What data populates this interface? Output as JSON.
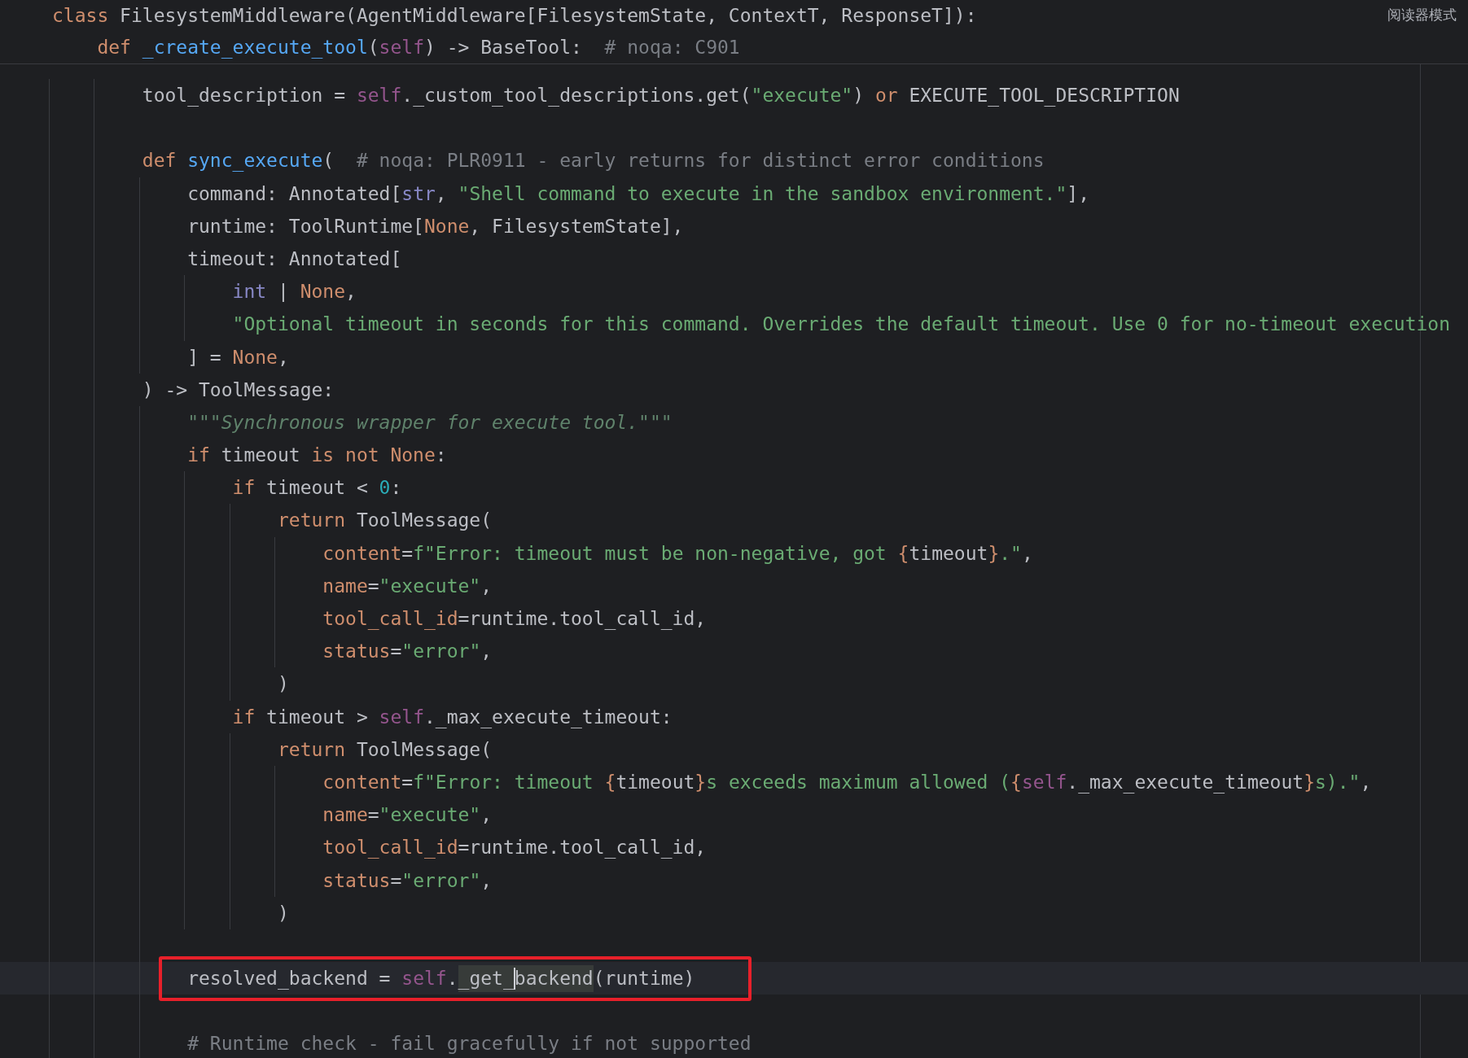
{
  "reader_mode_label": "阅读器模式",
  "sticky_lines": [
    {
      "tokens": [
        {
          "text": "class",
          "kind": "kw"
        },
        {
          "text": " FilesystemMiddleware(AgentMiddleware[FilesystemState, ContextT, ResponseT]):",
          "kind": "plain"
        }
      ]
    },
    {
      "tokens": [
        {
          "text": "    def ",
          "kind": "kw"
        },
        {
          "text": "_create_execute_tool",
          "kind": "fn"
        },
        {
          "text": "(",
          "kind": "plain"
        },
        {
          "text": "self",
          "kind": "self"
        },
        {
          "text": ") -> BaseTool:  ",
          "kind": "plain"
        },
        {
          "text": "# noqa: C901",
          "kind": "cmt"
        }
      ]
    }
  ],
  "lines": [
    {
      "kind": "code",
      "tokens": [
        {
          "text": "        tool_description = ",
          "kind": "plain"
        },
        {
          "text": "self",
          "kind": "self"
        },
        {
          "text": "._custom_tool_descriptions.get(",
          "kind": "plain"
        },
        {
          "text": "\"execute\"",
          "kind": "str"
        },
        {
          "text": ") ",
          "kind": "plain"
        },
        {
          "text": "or",
          "kind": "kw"
        },
        {
          "text": " EXECUTE_TOOL_DESCRIPTION",
          "kind": "plain"
        }
      ]
    },
    {
      "kind": "blank"
    },
    {
      "kind": "code",
      "tokens": [
        {
          "text": "        def ",
          "kind": "kw"
        },
        {
          "text": "sync_execute",
          "kind": "fn"
        },
        {
          "text": "(  ",
          "kind": "plain"
        },
        {
          "text": "# noqa: PLR0911 - early returns for distinct error conditions",
          "kind": "cmt"
        }
      ]
    },
    {
      "kind": "code",
      "tokens": [
        {
          "text": "            command: Annotated[",
          "kind": "plain"
        },
        {
          "text": "str",
          "kind": "builtin"
        },
        {
          "text": ", ",
          "kind": "plain"
        },
        {
          "text": "\"Shell command to execute in the sandbox environment.\"",
          "kind": "str"
        },
        {
          "text": "],",
          "kind": "plain"
        }
      ]
    },
    {
      "kind": "code",
      "tokens": [
        {
          "text": "            runtime: ToolRuntime[",
          "kind": "plain"
        },
        {
          "text": "None",
          "kind": "kw"
        },
        {
          "text": ", FilesystemState],",
          "kind": "plain"
        }
      ]
    },
    {
      "kind": "code",
      "tokens": [
        {
          "text": "            timeout: Annotated[",
          "kind": "plain"
        }
      ]
    },
    {
      "kind": "code",
      "tokens": [
        {
          "text": "                int",
          "kind": "builtin"
        },
        {
          "text": " | ",
          "kind": "plain"
        },
        {
          "text": "None",
          "kind": "kw"
        },
        {
          "text": ",",
          "kind": "plain"
        }
      ]
    },
    {
      "kind": "code",
      "tokens": [
        {
          "text": "                \"Optional timeout in seconds for this command. Overrides the default timeout. Use 0 for no-timeout execution",
          "kind": "str"
        }
      ]
    },
    {
      "kind": "code",
      "tokens": [
        {
          "text": "            ] = ",
          "kind": "plain"
        },
        {
          "text": "None",
          "kind": "kw"
        },
        {
          "text": ",",
          "kind": "plain"
        }
      ]
    },
    {
      "kind": "code",
      "tokens": [
        {
          "text": "        ) -> ToolMessage:",
          "kind": "plain"
        }
      ]
    },
    {
      "kind": "code",
      "tokens": [
        {
          "text": "            \"\"\"Synchronous wrapper for execute tool.\"\"\"",
          "kind": "doc"
        }
      ]
    },
    {
      "kind": "code",
      "tokens": [
        {
          "text": "            if",
          "kind": "kw"
        },
        {
          "text": " timeout ",
          "kind": "plain"
        },
        {
          "text": "is not None",
          "kind": "kw"
        },
        {
          "text": ":",
          "kind": "plain"
        }
      ]
    },
    {
      "kind": "code",
      "tokens": [
        {
          "text": "                if",
          "kind": "kw"
        },
        {
          "text": " timeout < ",
          "kind": "plain"
        },
        {
          "text": "0",
          "kind": "num"
        },
        {
          "text": ":",
          "kind": "plain"
        }
      ]
    },
    {
      "kind": "code",
      "tokens": [
        {
          "text": "                    return",
          "kind": "kw"
        },
        {
          "text": " ToolMessage(",
          "kind": "plain"
        }
      ]
    },
    {
      "kind": "code",
      "tokens": [
        {
          "text": "                        content",
          "kind": "param"
        },
        {
          "text": "=",
          "kind": "plain"
        },
        {
          "text": "f\"Error: timeout must be non-negative, got ",
          "kind": "str"
        },
        {
          "text": "{",
          "kind": "kw"
        },
        {
          "text": "timeout",
          "kind": "plain"
        },
        {
          "text": "}",
          "kind": "kw"
        },
        {
          "text": ".\"",
          "kind": "str"
        },
        {
          "text": ",",
          "kind": "plain"
        }
      ]
    },
    {
      "kind": "code",
      "tokens": [
        {
          "text": "                        name",
          "kind": "param"
        },
        {
          "text": "=",
          "kind": "plain"
        },
        {
          "text": "\"execute\"",
          "kind": "str"
        },
        {
          "text": ",",
          "kind": "plain"
        }
      ]
    },
    {
      "kind": "code",
      "tokens": [
        {
          "text": "                        tool_call_id",
          "kind": "param"
        },
        {
          "text": "=runtime.tool_call_id,",
          "kind": "plain"
        }
      ]
    },
    {
      "kind": "code",
      "tokens": [
        {
          "text": "                        status",
          "kind": "param"
        },
        {
          "text": "=",
          "kind": "plain"
        },
        {
          "text": "\"error\"",
          "kind": "str"
        },
        {
          "text": ",",
          "kind": "plain"
        }
      ]
    },
    {
      "kind": "code",
      "tokens": [
        {
          "text": "                    )",
          "kind": "plain"
        }
      ]
    },
    {
      "kind": "code",
      "tokens": [
        {
          "text": "                if",
          "kind": "kw"
        },
        {
          "text": " timeout > ",
          "kind": "plain"
        },
        {
          "text": "self",
          "kind": "self"
        },
        {
          "text": "._max_execute_timeout:",
          "kind": "plain"
        }
      ]
    },
    {
      "kind": "code",
      "tokens": [
        {
          "text": "                    return",
          "kind": "kw"
        },
        {
          "text": " ToolMessage(",
          "kind": "plain"
        }
      ]
    },
    {
      "kind": "code",
      "tokens": [
        {
          "text": "                        content",
          "kind": "param"
        },
        {
          "text": "=",
          "kind": "plain"
        },
        {
          "text": "f\"Error: timeout ",
          "kind": "str"
        },
        {
          "text": "{",
          "kind": "kw"
        },
        {
          "text": "timeout",
          "kind": "plain"
        },
        {
          "text": "}",
          "kind": "kw"
        },
        {
          "text": "s exceeds maximum allowed (",
          "kind": "str"
        },
        {
          "text": "{",
          "kind": "kw"
        },
        {
          "text": "self",
          "kind": "self"
        },
        {
          "text": "._max_execute_timeout",
          "kind": "plain"
        },
        {
          "text": "}",
          "kind": "kw"
        },
        {
          "text": "s).\"",
          "kind": "str"
        },
        {
          "text": ",",
          "kind": "plain"
        }
      ]
    },
    {
      "kind": "code",
      "tokens": [
        {
          "text": "                        name",
          "kind": "param"
        },
        {
          "text": "=",
          "kind": "plain"
        },
        {
          "text": "\"execute\"",
          "kind": "str"
        },
        {
          "text": ",",
          "kind": "plain"
        }
      ]
    },
    {
      "kind": "code",
      "tokens": [
        {
          "text": "                        tool_call_id",
          "kind": "param"
        },
        {
          "text": "=runtime.tool_call_id,",
          "kind": "plain"
        }
      ]
    },
    {
      "kind": "code",
      "tokens": [
        {
          "text": "                        status",
          "kind": "param"
        },
        {
          "text": "=",
          "kind": "plain"
        },
        {
          "text": "\"error\"",
          "kind": "str"
        },
        {
          "text": ",",
          "kind": "plain"
        }
      ]
    },
    {
      "kind": "code",
      "tokens": [
        {
          "text": "                    )",
          "kind": "plain"
        }
      ]
    },
    {
      "kind": "blank"
    },
    {
      "kind": "code",
      "current": true,
      "marked": true,
      "tokens": [
        {
          "text": "            resolved_backend = ",
          "kind": "plain"
        },
        {
          "text": "self",
          "kind": "self"
        },
        {
          "text": ".",
          "kind": "plain"
        },
        {
          "text": "_get_",
          "kind": "plain",
          "selected": true
        },
        {
          "text": "backend",
          "kind": "plain",
          "selected": true,
          "caret": true
        },
        {
          "text": "(runtime)",
          "kind": "plain"
        }
      ]
    },
    {
      "kind": "blank"
    },
    {
      "kind": "code",
      "tokens": [
        {
          "text": "            # Runtime check - fail gracefully if not supported",
          "kind": "cmt"
        }
      ]
    }
  ]
}
